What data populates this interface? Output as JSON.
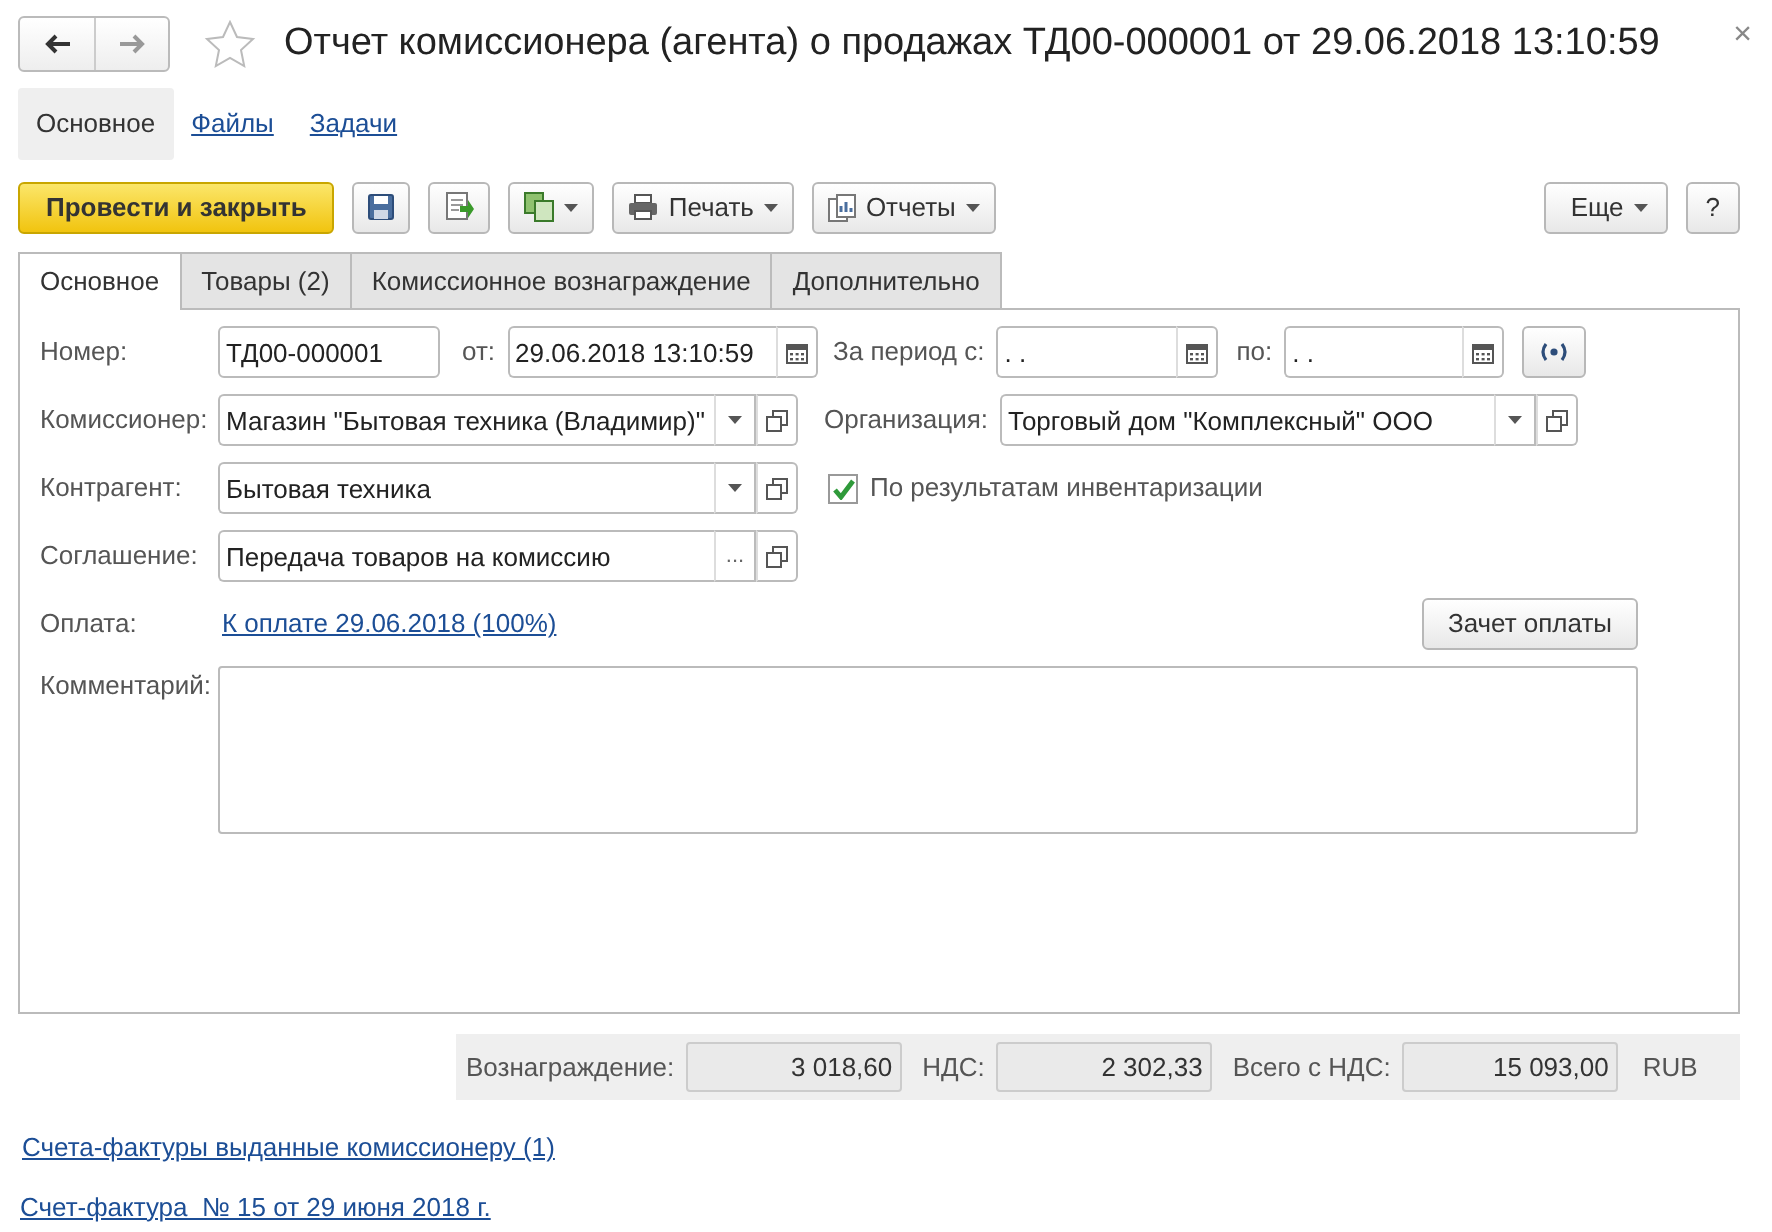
{
  "window": {
    "title": "Отчет комиссионера (агента) о продажах ТД00-000001 от 29.06.2018 13:10:59",
    "close": "×"
  },
  "sections": [
    {
      "label": "Основное",
      "selected": true
    },
    {
      "label": "Файлы",
      "selected": false
    },
    {
      "label": "Задачи",
      "selected": false
    }
  ],
  "toolbar": {
    "post_close": "Провести и закрыть",
    "print": "Печать",
    "reports": "Отчеты",
    "more": "Еще",
    "help": "?"
  },
  "tabs": [
    {
      "label": "Основное",
      "selected": true
    },
    {
      "label": "Товары (2)",
      "selected": false
    },
    {
      "label": "Комиссионное вознаграждение",
      "selected": false
    },
    {
      "label": "Дополнительно",
      "selected": false
    }
  ],
  "number": {
    "label": "Номер:",
    "value": "ТД00-000001"
  },
  "date": {
    "label": "от:",
    "value": "29.06.2018 13:10:59"
  },
  "period_from": {
    "label": "За период с:",
    "value": ". ."
  },
  "period_to": {
    "label": "по:",
    "value": ". ."
  },
  "commissioner": {
    "label": "Комиссионер:",
    "value": "Магазин \"Бытовая техника (Владимир)\""
  },
  "organization": {
    "label": "Организация:",
    "value": "Торговый дом \"Комплексный\" ООО"
  },
  "counterparty": {
    "label": "Контрагент:",
    "value": "Бытовая техника"
  },
  "inventory": {
    "label": "По результатам инвентаризации",
    "checked": true
  },
  "agreement": {
    "label": "Соглашение:",
    "value": "Передача товаров на комиссию",
    "select": "..."
  },
  "payment": {
    "label": "Оплата:",
    "link": "К оплате 29.06.2018 (100%)",
    "button": "Зачет оплаты"
  },
  "comment": {
    "label": "Комментарий:"
  },
  "totals": [
    {
      "label": "Вознаграждение:",
      "value": "3 018,60"
    },
    {
      "label": "НДС:",
      "value": "2 302,33"
    },
    {
      "label": "Всего с НДС:",
      "value": "15 093,00"
    }
  ],
  "currency": "RUB",
  "links": [
    "Счета-фактуры выданные комиссионеру (1)",
    "Счет-фактура  № 15 от 29 июня 2018 г."
  ]
}
